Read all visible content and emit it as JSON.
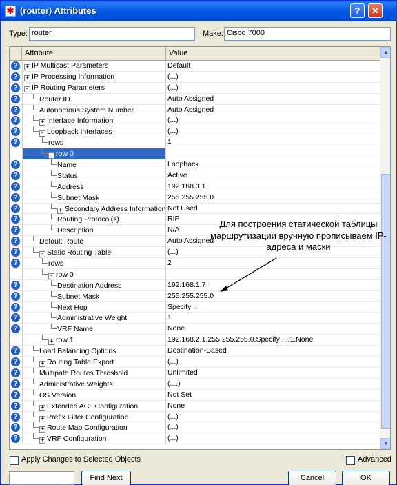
{
  "window": {
    "title": "(router) Attributes",
    "title_icon": "app-icon"
  },
  "type_field": {
    "label": "Type:",
    "value": "router"
  },
  "make_field": {
    "label": "Make:",
    "value": "Cisco 7000"
  },
  "table": {
    "headers": {
      "attribute": "Attribute",
      "value": "Value"
    },
    "rows": [
      {
        "indent": 0,
        "toggle": "+",
        "label": "IP Multicast Parameters",
        "value": "Default",
        "help": true
      },
      {
        "indent": 0,
        "toggle": "+",
        "label": "IP Processing Information",
        "value": "(...)",
        "help": true
      },
      {
        "indent": 0,
        "toggle": "-",
        "label": "IP Routing Parameters",
        "value": "(...)",
        "help": true
      },
      {
        "indent": 1,
        "toggle": "",
        "label": "Router ID",
        "value": "Auto Assigned",
        "help": true
      },
      {
        "indent": 1,
        "toggle": "",
        "label": "Autonomous System Number",
        "value": "Auto Assigned",
        "help": true
      },
      {
        "indent": 1,
        "toggle": "+",
        "label": "Interface Information",
        "value": "(...)",
        "help": true
      },
      {
        "indent": 1,
        "toggle": "-",
        "label": "Loopback Interfaces",
        "value": "(...)",
        "help": true
      },
      {
        "indent": 2,
        "toggle": "",
        "label": "rows",
        "value": "1",
        "help": true
      },
      {
        "indent": 2,
        "toggle": "-",
        "label": "row 0",
        "value": "",
        "help": false,
        "selected": true
      },
      {
        "indent": 3,
        "toggle": "",
        "label": "Name",
        "value": "Loopback",
        "help": true
      },
      {
        "indent": 3,
        "toggle": "",
        "label": "Status",
        "value": "Active",
        "help": true
      },
      {
        "indent": 3,
        "toggle": "",
        "label": "Address",
        "value": "192.168.3.1",
        "help": true
      },
      {
        "indent": 3,
        "toggle": "",
        "label": "Subnet Mask",
        "value": "255.255.255.0",
        "help": true
      },
      {
        "indent": 3,
        "toggle": "+",
        "label": "Secondary Address Information",
        "value": "Not Used",
        "help": true
      },
      {
        "indent": 3,
        "toggle": "",
        "label": "Routing Protocol(s)",
        "value": "RIP",
        "help": true
      },
      {
        "indent": 3,
        "toggle": "",
        "label": "Description",
        "value": "N/A",
        "help": true
      },
      {
        "indent": 1,
        "toggle": "",
        "label": "Default Route",
        "value": "Auto Assigned",
        "help": true
      },
      {
        "indent": 1,
        "toggle": "-",
        "label": "Static Routing Table",
        "value": "(...)",
        "help": true
      },
      {
        "indent": 2,
        "toggle": "",
        "label": "rows",
        "value": "2",
        "help": true
      },
      {
        "indent": 2,
        "toggle": "-",
        "label": "row 0",
        "value": "",
        "help": false
      },
      {
        "indent": 3,
        "toggle": "",
        "label": "Destination Address",
        "value": "192.168.1.7",
        "help": true
      },
      {
        "indent": 3,
        "toggle": "",
        "label": "Subnet Mask",
        "value": "255.255.255.0",
        "help": true
      },
      {
        "indent": 3,
        "toggle": "",
        "label": "Next Hop",
        "value": "Specify ...",
        "help": true
      },
      {
        "indent": 3,
        "toggle": "",
        "label": "Administrative Weight",
        "value": "1",
        "help": true
      },
      {
        "indent": 3,
        "toggle": "",
        "label": "VRF Name",
        "value": "None",
        "help": true
      },
      {
        "indent": 2,
        "toggle": "+",
        "label": "row 1",
        "value": "192.168.2.1,255.255.255.0,Specify ...,1,None",
        "help": false
      },
      {
        "indent": 1,
        "toggle": "",
        "label": "Load Balancing Options",
        "value": "Destination-Based",
        "help": true
      },
      {
        "indent": 1,
        "toggle": "+",
        "label": "Routing Table Export",
        "value": "(...)",
        "help": true
      },
      {
        "indent": 1,
        "toggle": "",
        "label": "Multipath Routes Threshold",
        "value": "Unlimited",
        "help": true
      },
      {
        "indent": 1,
        "toggle": "",
        "label": "Administrative Weights",
        "value": "(....)",
        "help": true
      },
      {
        "indent": 1,
        "toggle": "",
        "label": "OS Version",
        "value": "Not Set",
        "help": true
      },
      {
        "indent": 1,
        "toggle": "+",
        "label": "Extended ACL Configuration",
        "value": "None",
        "help": true
      },
      {
        "indent": 1,
        "toggle": "+",
        "label": "Prefix Filter Configuration",
        "value": "(...)",
        "help": true
      },
      {
        "indent": 1,
        "toggle": "+",
        "label": "Route Map Configuration",
        "value": "(...)",
        "help": true
      },
      {
        "indent": 1,
        "toggle": "+",
        "label": "VRF Configuration",
        "value": "(...)",
        "help": true
      }
    ]
  },
  "annotation": "Для построения статической таблицы маршрутизации вручную прописываем IP-адреса и маски",
  "bottom": {
    "apply_label": "Apply Changes to Selected Objects",
    "advanced_label": "Advanced",
    "search_value": "",
    "find_next": "Find Next",
    "cancel": "Cancel",
    "ok": "OK"
  },
  "colors": {
    "title_bar": "#0058e6",
    "selection": "#316ac5",
    "help_icon": "#1f5fc9"
  }
}
